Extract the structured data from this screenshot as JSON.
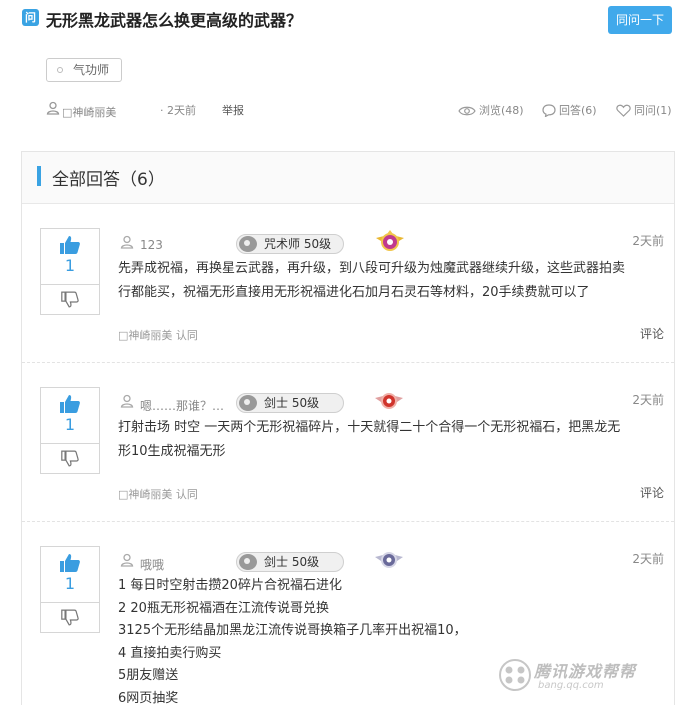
{
  "question": {
    "badge": "问",
    "title": "无形黑龙武器怎么换更高级的武器？",
    "same_question_button": "同问一下",
    "tag": "气功师",
    "asker": "□神崎丽美",
    "time": "· 2天前",
    "report": "举报",
    "views": "浏览(48)",
    "answers_count": "回答(6)",
    "same_count": "同问(1)"
  },
  "answers_section": {
    "title": "全部回答（6）"
  },
  "answers": [
    {
      "votes": "1",
      "user": "123",
      "level": "咒术师 50级",
      "time": "2天前",
      "lines": [
        "先弄成祝福，再换星云武器，再升级，到八段可升级为烛魔武器继续升级，这些武器拍卖",
        "行都能买，祝福无形直接用无形祝福进化石加月石灵石等材料，20手续费就可以了"
      ],
      "agree": "□神崎丽美 认同",
      "comment": "评论"
    },
    {
      "votes": "1",
      "user": "嗯……那谁？…",
      "level": "剑士 50级",
      "time": "2天前",
      "lines": [
        "打射击场 时空 一天两个无形祝福碎片，十天就得二十个合得一个无形祝福石，把黑龙无",
        "形10生成祝福无形"
      ],
      "agree": "□神崎丽美 认同",
      "comment": "评论"
    },
    {
      "votes": "1",
      "user": "哦哦",
      "level": "剑士 50级",
      "time": "2天前",
      "lines": [
        "1 每日时空射击攒20碎片合祝福石进化",
        "2 20瓶无形祝福酒在江流传说哥兑换",
        "3125个无形结晶加黑龙江流传说哥换箱子几率开出祝福10，",
        "4 直接拍卖行购买",
        "5朋友赠送",
        "6网页抽奖"
      ]
    }
  ],
  "watermark": {
    "text": "腾讯游戏帮帮",
    "sub": "bang.qq.com"
  },
  "colors": {
    "accent": "#3aa3e3",
    "button": "#40a9eb",
    "vote": "#3a9de0"
  }
}
